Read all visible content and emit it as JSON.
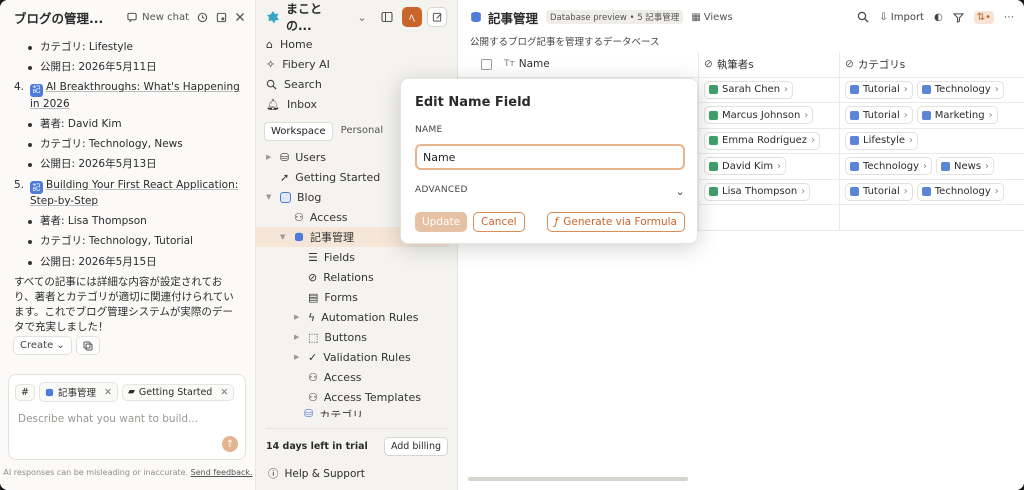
{
  "chat": {
    "title": "ブログの管理...",
    "new_chat_label": "New chat",
    "lines": {
      "l1": "カテゴリ: Lifestyle",
      "l2": "公開日: 2026年5月11日"
    },
    "items": [
      {
        "num": "4.",
        "tag": "記",
        "title": "AI Breakthroughs: What's Happening in 2026",
        "author": "著者: David Kim",
        "category": "カテゴリ: Technology, News",
        "date": "公開日: 2026年5月13日"
      },
      {
        "num": "5.",
        "tag": "記",
        "title": "Building Your First React Application: Step-by-Step",
        "author": "著者: Lisa Thompson",
        "category": "カテゴリ: Technology, Tutorial",
        "date": "公開日: 2026年5月15日"
      }
    ],
    "summary": "すべての記事には詳細な内容が設定されており、著者とカテゴリが適切に関連付けられています。これでブログ管理システムが実際のデータで充実しました！",
    "create_label": "Create",
    "chips": [
      "記事管理",
      "Getting Started"
    ],
    "chip_hash": "#",
    "placeholder": "Describe what you want to build...",
    "disclaimer": "AI responses can be misleading or inaccurate.",
    "feedback": "Send feedback."
  },
  "sidebar": {
    "workspace": "まことの...",
    "ws_badge": "ﾍ",
    "nav": [
      "Home",
      "Fibery AI",
      "Search",
      "Inbox"
    ],
    "tabs": [
      "Workspace",
      "Personal"
    ],
    "tree": {
      "users": "Users",
      "getting_started": "Getting Started",
      "blog": "Blog",
      "access": "Access",
      "kiji": "記事管理",
      "fields": "Fields",
      "relations": "Relations",
      "forms": "Forms",
      "automation": "Automation Rules",
      "buttons": "Buttons",
      "validation": "Validation Rules",
      "access2": "Access",
      "access_templates": "Access Templates",
      "category": "カテゴリ"
    },
    "trial": "14 days left in trial",
    "billing": "Add billing",
    "help": "Help & Support"
  },
  "main": {
    "title": "記事管理",
    "badge": "Database preview • 5 記事管理",
    "views": "Views",
    "import": "Import",
    "subtitle": "公開するブログ記事を管理するデータベース",
    "columns": [
      "Name",
      "執筆者s",
      "カテゴリs"
    ],
    "rows": [
      {
        "author": "Sarah Chen",
        "cats": [
          "Tutorial",
          "Technology"
        ]
      },
      {
        "author": "Marcus Johnson",
        "cats": [
          "Tutorial",
          "Marketing"
        ]
      },
      {
        "author": "Emma Rodriguez",
        "cats": [
          "Lifestyle"
        ]
      },
      {
        "author": "David Kim",
        "cats": [
          "Technology",
          "News"
        ]
      },
      {
        "author": "Lisa Thompson",
        "cats": [
          "Tutorial",
          "Technology"
        ]
      }
    ]
  },
  "modal": {
    "title": "Edit Name Field",
    "name_label": "NAME",
    "name_value": "Name",
    "advanced": "ADVANCED",
    "update": "Update",
    "cancel": "Cancel",
    "generate": "Generate via Formula"
  },
  "colors": {
    "accent": "#c9642b",
    "author_dot": "#3fa06b",
    "cat_dot": "#5b86d6"
  }
}
